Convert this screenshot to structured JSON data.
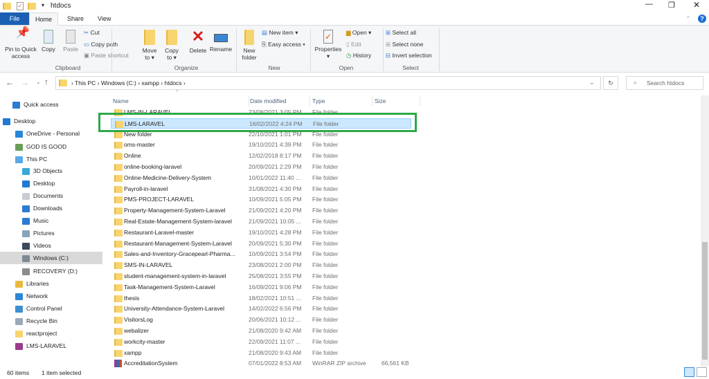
{
  "window": {
    "title": "htdocs"
  },
  "tabs": [
    {
      "label": "File"
    },
    {
      "label": "Home"
    },
    {
      "label": "Share"
    },
    {
      "label": "View"
    }
  ],
  "ribbon": {
    "clipboard": {
      "pin": "Pin to Quick access",
      "copy": "Copy",
      "paste": "Paste",
      "cut": "Cut",
      "copy_path": "Copy path",
      "paste_shortcut": "Paste shortcut",
      "label": "Clipboard"
    },
    "organize": {
      "move_to": "Move to ▾",
      "copy_to": "Copy to ▾",
      "delete": "Delete",
      "rename": "Rename",
      "label": "Organize"
    },
    "new": {
      "new_folder": "New folder",
      "new_item": "New item ▾",
      "easy_access": "Easy access ▾",
      "label": "New"
    },
    "open": {
      "properties": "Properties",
      "open": "Open ▾",
      "edit": "Edit",
      "history": "History",
      "label": "Open"
    },
    "select": {
      "select_all": "Select all",
      "select_none": "Select none",
      "invert": "Invert selection",
      "label": "Select"
    }
  },
  "address": {
    "crumbs": [
      "This PC",
      "Windows (C:)",
      "xampp",
      "htdocs"
    ],
    "search_placeholder": "Search htdocs"
  },
  "sidebar": [
    {
      "label": "Quick access",
      "color": "#2b7cd3"
    },
    {
      "label": "Desktop",
      "color": "#1e7ad6"
    },
    {
      "label": "OneDrive - Personal",
      "color": "#2a86d9"
    },
    {
      "label": "GOD IS GOOD",
      "color": "#6a9d58"
    },
    {
      "label": "This PC",
      "color": "#5aa8e6"
    },
    {
      "label": "3D Objects",
      "color": "#38a9d8"
    },
    {
      "label": "Desktop",
      "color": "#1e7ad6"
    },
    {
      "label": "Documents",
      "color": "#c9cdd3"
    },
    {
      "label": "Downloads",
      "color": "#2d7bd0"
    },
    {
      "label": "Music",
      "color": "#2d7bd0"
    },
    {
      "label": "Pictures",
      "color": "#8aa3b8"
    },
    {
      "label": "Videos",
      "color": "#3c4b5c"
    },
    {
      "label": "Windows (C:)",
      "color": "#7d8a96"
    },
    {
      "label": "RECOVERY (D:)",
      "color": "#8c8c8c"
    },
    {
      "label": "Libraries",
      "color": "#e8b93e"
    },
    {
      "label": "Network",
      "color": "#2f86d6"
    },
    {
      "label": "Control Panel",
      "color": "#3e8fd0"
    },
    {
      "label": "Recycle Bin",
      "color": "#9aa9b8"
    },
    {
      "label": "reactproject",
      "color": "#f7d46e"
    },
    {
      "label": "LMS-LARAVEL",
      "color": "#9b3b8c"
    }
  ],
  "columns": {
    "name": "Name",
    "date": "Date modified",
    "type": "Type",
    "size": "Size"
  },
  "files": [
    {
      "name": "LMS-IN-LARAVEL",
      "date": "23/08/2021 3:05 PM",
      "type": "File folder",
      "size": ""
    },
    {
      "name": "LMS-LARAVEL",
      "date": "16/02/2022 4:24 PM",
      "type": "File folder",
      "size": ""
    },
    {
      "name": "New folder",
      "date": "22/10/2021 1:01 PM",
      "type": "File folder",
      "size": ""
    },
    {
      "name": "oms-master",
      "date": "19/10/2021 4:39 PM",
      "type": "File folder",
      "size": ""
    },
    {
      "name": "Online",
      "date": "12/02/2018 8:17 PM",
      "type": "File folder",
      "size": ""
    },
    {
      "name": "online-booking-laravel",
      "date": "20/09/2021 2:29 PM",
      "type": "File folder",
      "size": ""
    },
    {
      "name": "Online-Medicine-Delivery-System",
      "date": "10/01/2022 11:40 ...",
      "type": "File folder",
      "size": ""
    },
    {
      "name": "Payroll-in-laravel",
      "date": "31/08/2021 4:30 PM",
      "type": "File folder",
      "size": ""
    },
    {
      "name": "PMS-PROJECT-LARAVEL",
      "date": "10/09/2021 5:05 PM",
      "type": "File folder",
      "size": ""
    },
    {
      "name": "Property-Management-System-Laravel",
      "date": "21/09/2021 4:20 PM",
      "type": "File folder",
      "size": ""
    },
    {
      "name": "Real-Estate-Management-System-laravel",
      "date": "21/09/2021 10:05 ...",
      "type": "File folder",
      "size": ""
    },
    {
      "name": "Restaurant-Laravel-master",
      "date": "19/10/2021 4:28 PM",
      "type": "File folder",
      "size": ""
    },
    {
      "name": "Restaurant-Management-System-Laravel",
      "date": "20/09/2021 5:30 PM",
      "type": "File folder",
      "size": ""
    },
    {
      "name": "Sales-and-Inventory-Gracepearl-Pharma...",
      "date": "10/09/2021 3:54 PM",
      "type": "File folder",
      "size": ""
    },
    {
      "name": "SMS-IN-LARAVEL",
      "date": "23/08/2021 2:00 PM",
      "type": "File folder",
      "size": ""
    },
    {
      "name": "student-management-system-in-laravel",
      "date": "25/08/2021 3:55 PM",
      "type": "File folder",
      "size": ""
    },
    {
      "name": "Task-Management-System-Laravel",
      "date": "16/09/2021 9:06 PM",
      "type": "File folder",
      "size": ""
    },
    {
      "name": "thesis",
      "date": "18/02/2021 10:51 ...",
      "type": "File folder",
      "size": ""
    },
    {
      "name": "University-Attendance-System-Laravel",
      "date": "14/02/2022 6:56 PM",
      "type": "File folder",
      "size": ""
    },
    {
      "name": "VisitorsLog",
      "date": "20/06/2021 10:12 ...",
      "type": "File folder",
      "size": ""
    },
    {
      "name": "webalizer",
      "date": "21/08/2020 9:42 AM",
      "type": "File folder",
      "size": ""
    },
    {
      "name": "workcity-master",
      "date": "22/09/2021 11:07 ...",
      "type": "File folder",
      "size": ""
    },
    {
      "name": "xampp",
      "date": "21/08/2020 9:43 AM",
      "type": "File folder",
      "size": ""
    },
    {
      "name": "AccreditationSystem",
      "date": "07/01/2022 8:53 AM",
      "type": "WinRAR ZIP archive",
      "size": "66,561 KB"
    }
  ],
  "selected_index": 1,
  "status": {
    "count": "60 items",
    "selected": "1 item selected"
  },
  "colors": {
    "accent": "#1a5fb4",
    "highlight": "#2ea84a",
    "selection": "#cce8ff"
  }
}
